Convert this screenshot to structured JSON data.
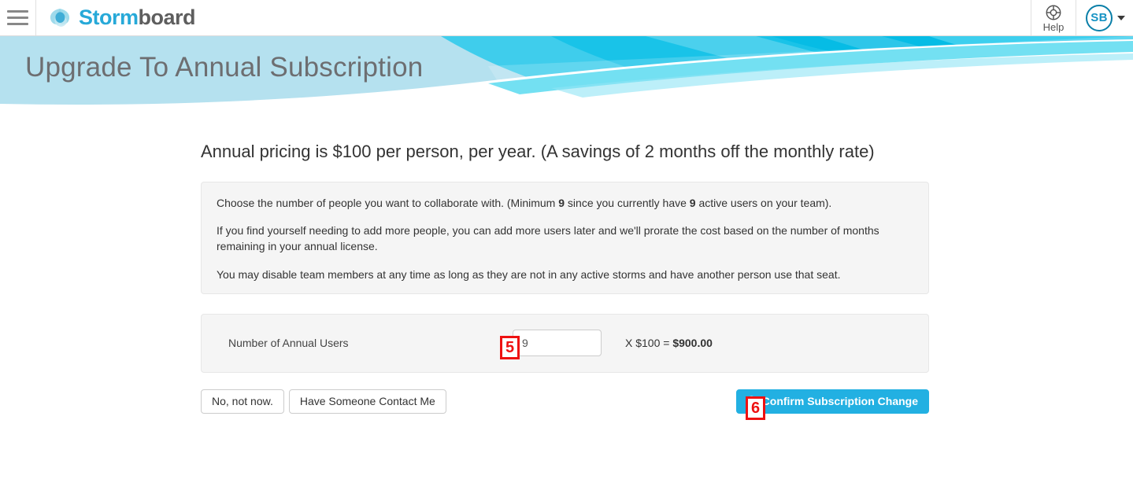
{
  "topbar": {
    "menu_icon": "hamburger-menu-icon",
    "brand_first": "Storm",
    "brand_second": "board",
    "brand_mark_icon": "stormboard-logo-icon",
    "help_icon": "lifebuoy-icon",
    "help_label": "Help",
    "avatar_initials": "SB",
    "account_caret_icon": "chevron-down-icon"
  },
  "hero": {
    "title": "Upgrade To Annual Subscription",
    "accent_light": "#b5e1ef",
    "accent_mid": "#3fcdec",
    "accent_deep": "#00b9e4",
    "accent_dark": "#00c6e8"
  },
  "main": {
    "lead": "Annual pricing is $100 per person, per year. (A savings of 2 months off the monthly rate)",
    "info_paragraphs": [
      {
        "prefix": "Choose the number of people you want to collaborate with. (Minimum ",
        "bold1": "9",
        "middle": " since you currently have ",
        "bold2": "9",
        "suffix": " active users on your team)."
      },
      {
        "text": "If you find yourself needing to add more people, you can add more users later and we'll prorate the cost based on the number of months remaining in your annual license."
      },
      {
        "text": "You may disable team members at any time as long as they are not in any active storms and have another person use that seat."
      }
    ],
    "users_row": {
      "label": "Number of Annual Users",
      "input_value": "9",
      "input_placeholder": "",
      "calc_prefix": "X $100 = ",
      "calc_total": "$900.00"
    },
    "buttons": {
      "decline": "No, not now.",
      "contact": "Have Someone Contact Me",
      "confirm": "Confirm Subscription Change",
      "confirm_icon": "check-circle-icon",
      "confirm_color": "#22b0e2"
    }
  },
  "annotations": [
    {
      "id": "5",
      "label": "5",
      "color": "#ee1111"
    },
    {
      "id": "6",
      "label": "6",
      "color": "#ee1111"
    }
  ]
}
